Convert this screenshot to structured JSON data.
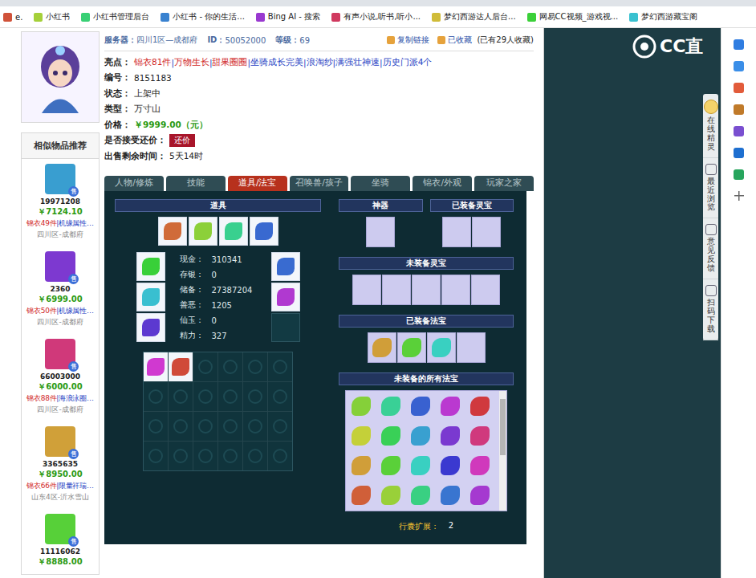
{
  "browser": {
    "bookmarks": [
      "e.",
      "小红书",
      "小红书管理后台",
      "小红书 - 你的生活...",
      "Bing AI - 搜索",
      "有声小说,听书,听小...",
      "梦幻西游达人后台...",
      "网易CC视频_游戏视...",
      "梦幻西游藏宝阁"
    ]
  },
  "sidebar": {
    "title": "相似物品推荐",
    "items": [
      {
        "id": "19971208",
        "price": "￥7124.10",
        "tag": "锦衣49件",
        "desc": "|机缘属性…",
        "server": "四川区-成都府",
        "badge": "售"
      },
      {
        "id": "2360",
        "price": "￥6999.00",
        "tag": "锦衣50件",
        "desc": "|机缘属性…",
        "server": "四川区-成都府",
        "badge": "售"
      },
      {
        "id": "66003000",
        "price": "￥6000.00",
        "tag": "锦衣88件",
        "desc": "|海浪泳圈…",
        "server": "四川区-成都府",
        "badge": "售"
      },
      {
        "id": "3365635",
        "price": "￥8950.00",
        "tag": "锦衣66件",
        "desc": "|限量祥瑞…",
        "server": "山东4区-沂水雪山",
        "badge": "售"
      },
      {
        "id": "11116062",
        "price": "￥8888.00",
        "tag": "",
        "desc": "",
        "server": "",
        "badge": "售"
      }
    ]
  },
  "header": {
    "server_label": "服务器：",
    "server": "四川1区—成都府",
    "id_label": "ID：",
    "id": "50052000",
    "level_label": "等级：",
    "level": "69",
    "copy": "复制链接",
    "fav": "已收藏",
    "fav_count": "(已有29人收藏)"
  },
  "info": {
    "highlights_label": "亮点：",
    "separator": "|",
    "highlights": [
      {
        "text": "锦衣81件",
        "color": "#d11f1f"
      },
      {
        "text": "万物生长",
        "color": "#d11f1f"
      },
      {
        "text": "甜果圈圈",
        "color": "#d11f1f"
      },
      {
        "text": "坐骑成长完美",
        "color": "#1f3fc4"
      },
      {
        "text": "浪淘纱",
        "color": "#1f3fc4"
      },
      {
        "text": "满强壮神速",
        "color": "#1f3fc4"
      },
      {
        "text": "历史门派4个",
        "color": "#1f3fc4"
      }
    ],
    "rows": [
      {
        "label": "编号：",
        "value": "8151183",
        "kind": "text"
      },
      {
        "label": "状态：",
        "value": "上架中",
        "kind": "text"
      },
      {
        "label": "类型：",
        "value": "万寸山",
        "kind": "text"
      },
      {
        "label": "价格：",
        "value": "￥9999.00（元）",
        "kind": "price"
      },
      {
        "label": "是否接受还价：",
        "value": "还价",
        "kind": "button"
      },
      {
        "label": "出售剩余时间：",
        "value": "5天14时",
        "kind": "text"
      }
    ]
  },
  "tabs": [
    {
      "label": "人物/修炼",
      "selected": false
    },
    {
      "label": "技能",
      "selected": false
    },
    {
      "label": "道具/法宝",
      "selected": true
    },
    {
      "label": "召唤兽/孩子",
      "selected": false
    },
    {
      "label": "坐骑",
      "selected": false
    },
    {
      "label": "锦衣/外观",
      "selected": false
    },
    {
      "label": "玩家之家",
      "selected": false
    }
  ],
  "inventory": {
    "title": "道具",
    "equipped": [
      true,
      true,
      true,
      true
    ],
    "side_left": [
      true,
      true,
      true
    ],
    "side_right": [
      true,
      true,
      false
    ],
    "stats": [
      {
        "label": "现金：",
        "value": "310341"
      },
      {
        "label": "存银：",
        "value": "0"
      },
      {
        "label": "储备：",
        "value": "27387204"
      },
      {
        "label": "善恶：",
        "value": "1205"
      },
      {
        "label": "仙玉：",
        "value": "0"
      },
      {
        "label": "精力：",
        "value": "327"
      }
    ],
    "bag": [
      true,
      true,
      false,
      false,
      false,
      false,
      false,
      false,
      false,
      false,
      false,
      false,
      false,
      false,
      false,
      false,
      false,
      false,
      false,
      false,
      false,
      false,
      false,
      false
    ],
    "shenqi": {
      "title": "神器",
      "slots": [
        false
      ]
    },
    "lingbao_equipped": {
      "title": "已装备灵宝",
      "slots": [
        false,
        false
      ]
    },
    "lingbao_unequipped": {
      "title": "未装备灵宝",
      "slots": [
        false,
        false,
        false,
        false,
        false
      ]
    },
    "fabao_equipped": {
      "title": "已装备法宝",
      "slots": [
        true,
        true,
        true,
        false
      ]
    },
    "fabao_all": {
      "title": "未装备的所有法宝",
      "slots": [
        true,
        true,
        true,
        true,
        true,
        true,
        true,
        true,
        true,
        true,
        true,
        true,
        true,
        true,
        true,
        true,
        true,
        true,
        true,
        true
      ]
    },
    "expand_label": "行囊扩展：",
    "expand_value": "2"
  },
  "logo": "CC直",
  "float_panel": [
    {
      "label": "在线精灵"
    },
    {
      "label": "最近浏览"
    },
    {
      "label": "意见反馈"
    },
    {
      "label": "扫码下载"
    }
  ]
}
